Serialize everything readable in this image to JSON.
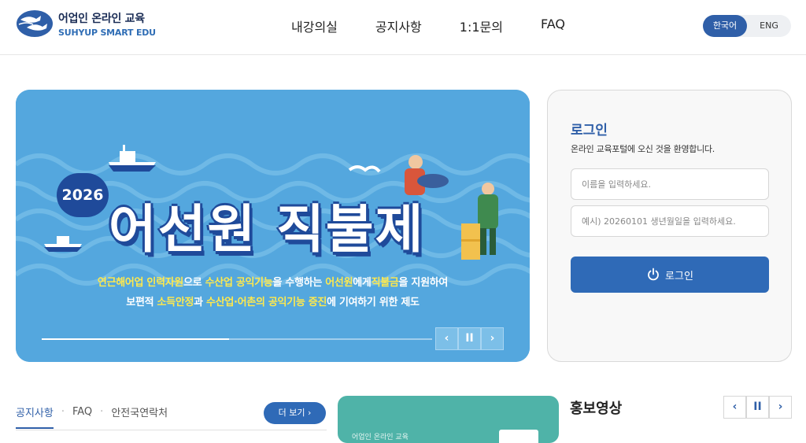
{
  "brand": {
    "name_kr": "어업인 온라인 교육",
    "name_en": "SUHYUP SMART EDU"
  },
  "nav": {
    "items": [
      "내강의실",
      "공지사항",
      "1:1문의",
      "FAQ"
    ]
  },
  "lang": {
    "kr": "한국어",
    "en": "ENG",
    "active": "한국어"
  },
  "banner": {
    "year": "2026",
    "headline": "어선원 직불제",
    "line1": {
      "a": "연근해어업 인력자원",
      "b": "으로 ",
      "c": "수산업 공익기능",
      "d": "을 수행하는 ",
      "e": "어선원",
      "f": "에게",
      "g": "직불금",
      "h": "을 지원하여"
    },
    "line2": {
      "a": "보편적 ",
      "b": "소득안정",
      "c": "과 ",
      "d": "수산업·어촌의 공익기능 증진",
      "e": "에 기여하기 위한 제도"
    },
    "progress": 0.48,
    "prev": "‹",
    "pause": "II",
    "next": "›"
  },
  "login": {
    "title": "로그인",
    "subtitle": "온라인 교육포털에 오신 것을 환영합니다.",
    "name_placeholder": "이름을 입력하세요.",
    "birth_placeholder": "예시) 20260101 생년월일을 입력하세요.",
    "button": "로그인"
  },
  "notice": {
    "tabs": [
      "공지사항",
      "FAQ",
      "안전국연락처"
    ],
    "active_tab": "공지사항",
    "more": "더 보기 ›"
  },
  "promo": {
    "small": "어업인 온라인 교육"
  },
  "video": {
    "title": "홍보영상",
    "prev": "‹",
    "pause": "II",
    "next": "›"
  },
  "colors": {
    "primary": "#2f6ab7",
    "banner_bg": "#54a7de",
    "highlight": "#ffe94d",
    "promo_bg": "#4fb3a8"
  }
}
